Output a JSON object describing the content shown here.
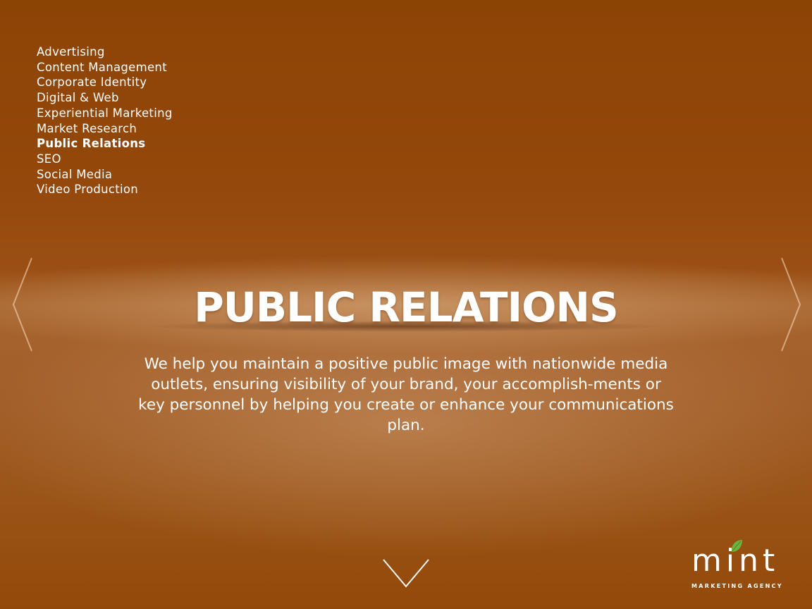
{
  "nav": {
    "items": [
      {
        "label": "Advertising",
        "active": false
      },
      {
        "label": "Content Management",
        "active": false
      },
      {
        "label": "Corporate Identity",
        "active": false
      },
      {
        "label": "Digital & Web",
        "active": false
      },
      {
        "label": "Experiential Marketing",
        "active": false
      },
      {
        "label": "Market Research",
        "active": false
      },
      {
        "label": "Public Relations",
        "active": true
      },
      {
        "label": "SEO",
        "active": false
      },
      {
        "label": "Social Media",
        "active": false
      },
      {
        "label": "Video Production",
        "active": false
      }
    ]
  },
  "main": {
    "title": "PUBLIC RELATIONS",
    "description": "We help you maintain a positive public image with nationwide media outlets, ensuring visibility of your brand, your accomplish-ments or key personnel by helping you create or enhance your communications plan."
  },
  "navigation_arrows": {
    "left_icon": "chevron-left-icon",
    "right_icon": "chevron-right-icon",
    "down_icon": "chevron-down-icon"
  },
  "logo": {
    "wordmark": "mint",
    "tagline": "MARKETING AGENCY",
    "leaf_icon": "leaf-icon",
    "leaf_color": "#6db33f"
  },
  "colors": {
    "background": "#9a4f14",
    "text": "#ffffff"
  }
}
